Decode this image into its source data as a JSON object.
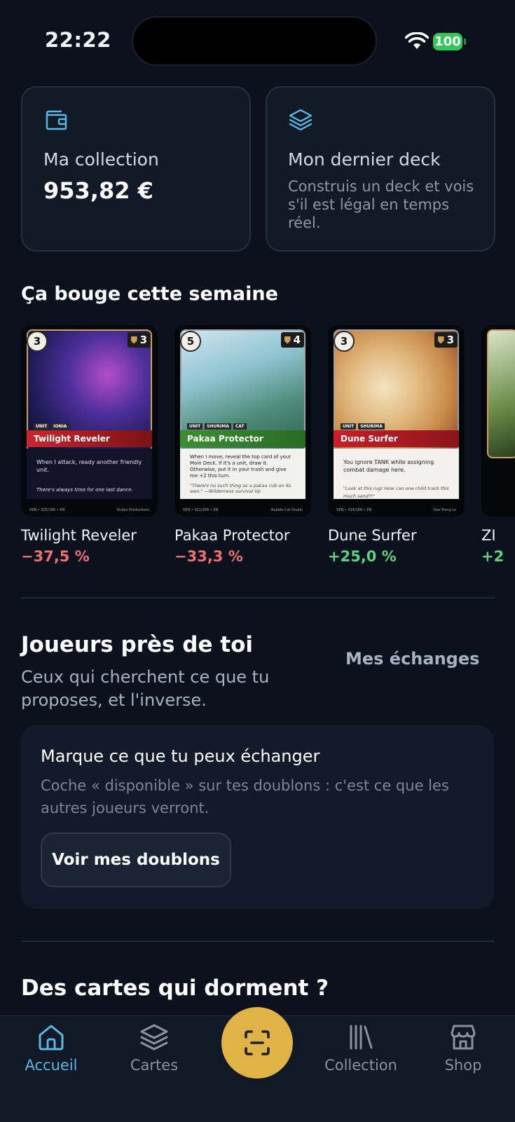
{
  "status_bar": {
    "time": "22:22",
    "battery": "100"
  },
  "summary": {
    "collection": {
      "title": "Ma collection",
      "value": "953,82 €"
    },
    "deck": {
      "title": "Mon dernier deck",
      "description": "Construis un deck et vois s'il est légal en temps réel."
    }
  },
  "trending": {
    "title": "Ça bouge cette semaine",
    "cards": [
      {
        "name": "Twilight Reveler",
        "change": "−37,5 %",
        "cost": "3",
        "might": "3",
        "tags": [
          "UNIT",
          "IONIA"
        ],
        "ability": "When I attack, ready another friendly unit.",
        "flavor": "There's always time for one last dance.",
        "footer": "VEN • 025/166 • EN",
        "artist": "Kudos Productions"
      },
      {
        "name": "Pakaa Protector",
        "change": "−33,3 %",
        "cost": "5",
        "might": "4",
        "tags": [
          "UNIT",
          "SHURIMA",
          "CAT"
        ],
        "ability": "When I move, reveal the top card of your Main Deck. If it's a unit, draw it. Otherwise, put it in your trash and give me +2 this turn.",
        "flavor": "\"There's no such thing as a pakaa cub on its own.\" —Wilderness survival tip",
        "footer": "VEN • 021/166 • EN",
        "artist": "Bubble Cat Studio"
      },
      {
        "name": "Dune Surfer",
        "change": "+25,0 %",
        "cost": "3",
        "might": "3",
        "tags": [
          "UNIT",
          "SHURIMA"
        ],
        "ability": "You ignore TANK while assigning combat damage here.",
        "flavor": "\"Look at this rug! How can one child track this much sand?!\"",
        "footer": "VEN • 014/166 • EN",
        "artist": "Dao Trong Le"
      },
      {
        "name": "ZI",
        "change": "+2"
      }
    ]
  },
  "players": {
    "title": "Joueurs près de toi",
    "subtitle": "Ceux qui cherchent ce que tu proposes, et l'inverse.",
    "link": "Mes échanges",
    "box": {
      "title": "Marque ce que tu peux échanger",
      "description": "Coche « disponible » sur tes doublons : c'est ce que les autres joueurs verront.",
      "button": "Voir mes doublons"
    }
  },
  "dormant": {
    "title": "Des cartes qui dorment ?"
  },
  "tabbar": {
    "active_color": "#5ab8e4",
    "accent": "#e0b349",
    "items": [
      {
        "label": "Accueil",
        "icon": "home-icon",
        "active": true
      },
      {
        "label": "Cartes",
        "icon": "stack-icon"
      },
      {
        "label": "Collection",
        "icon": "library-icon"
      },
      {
        "label": "Shop",
        "icon": "store-icon"
      }
    ]
  }
}
